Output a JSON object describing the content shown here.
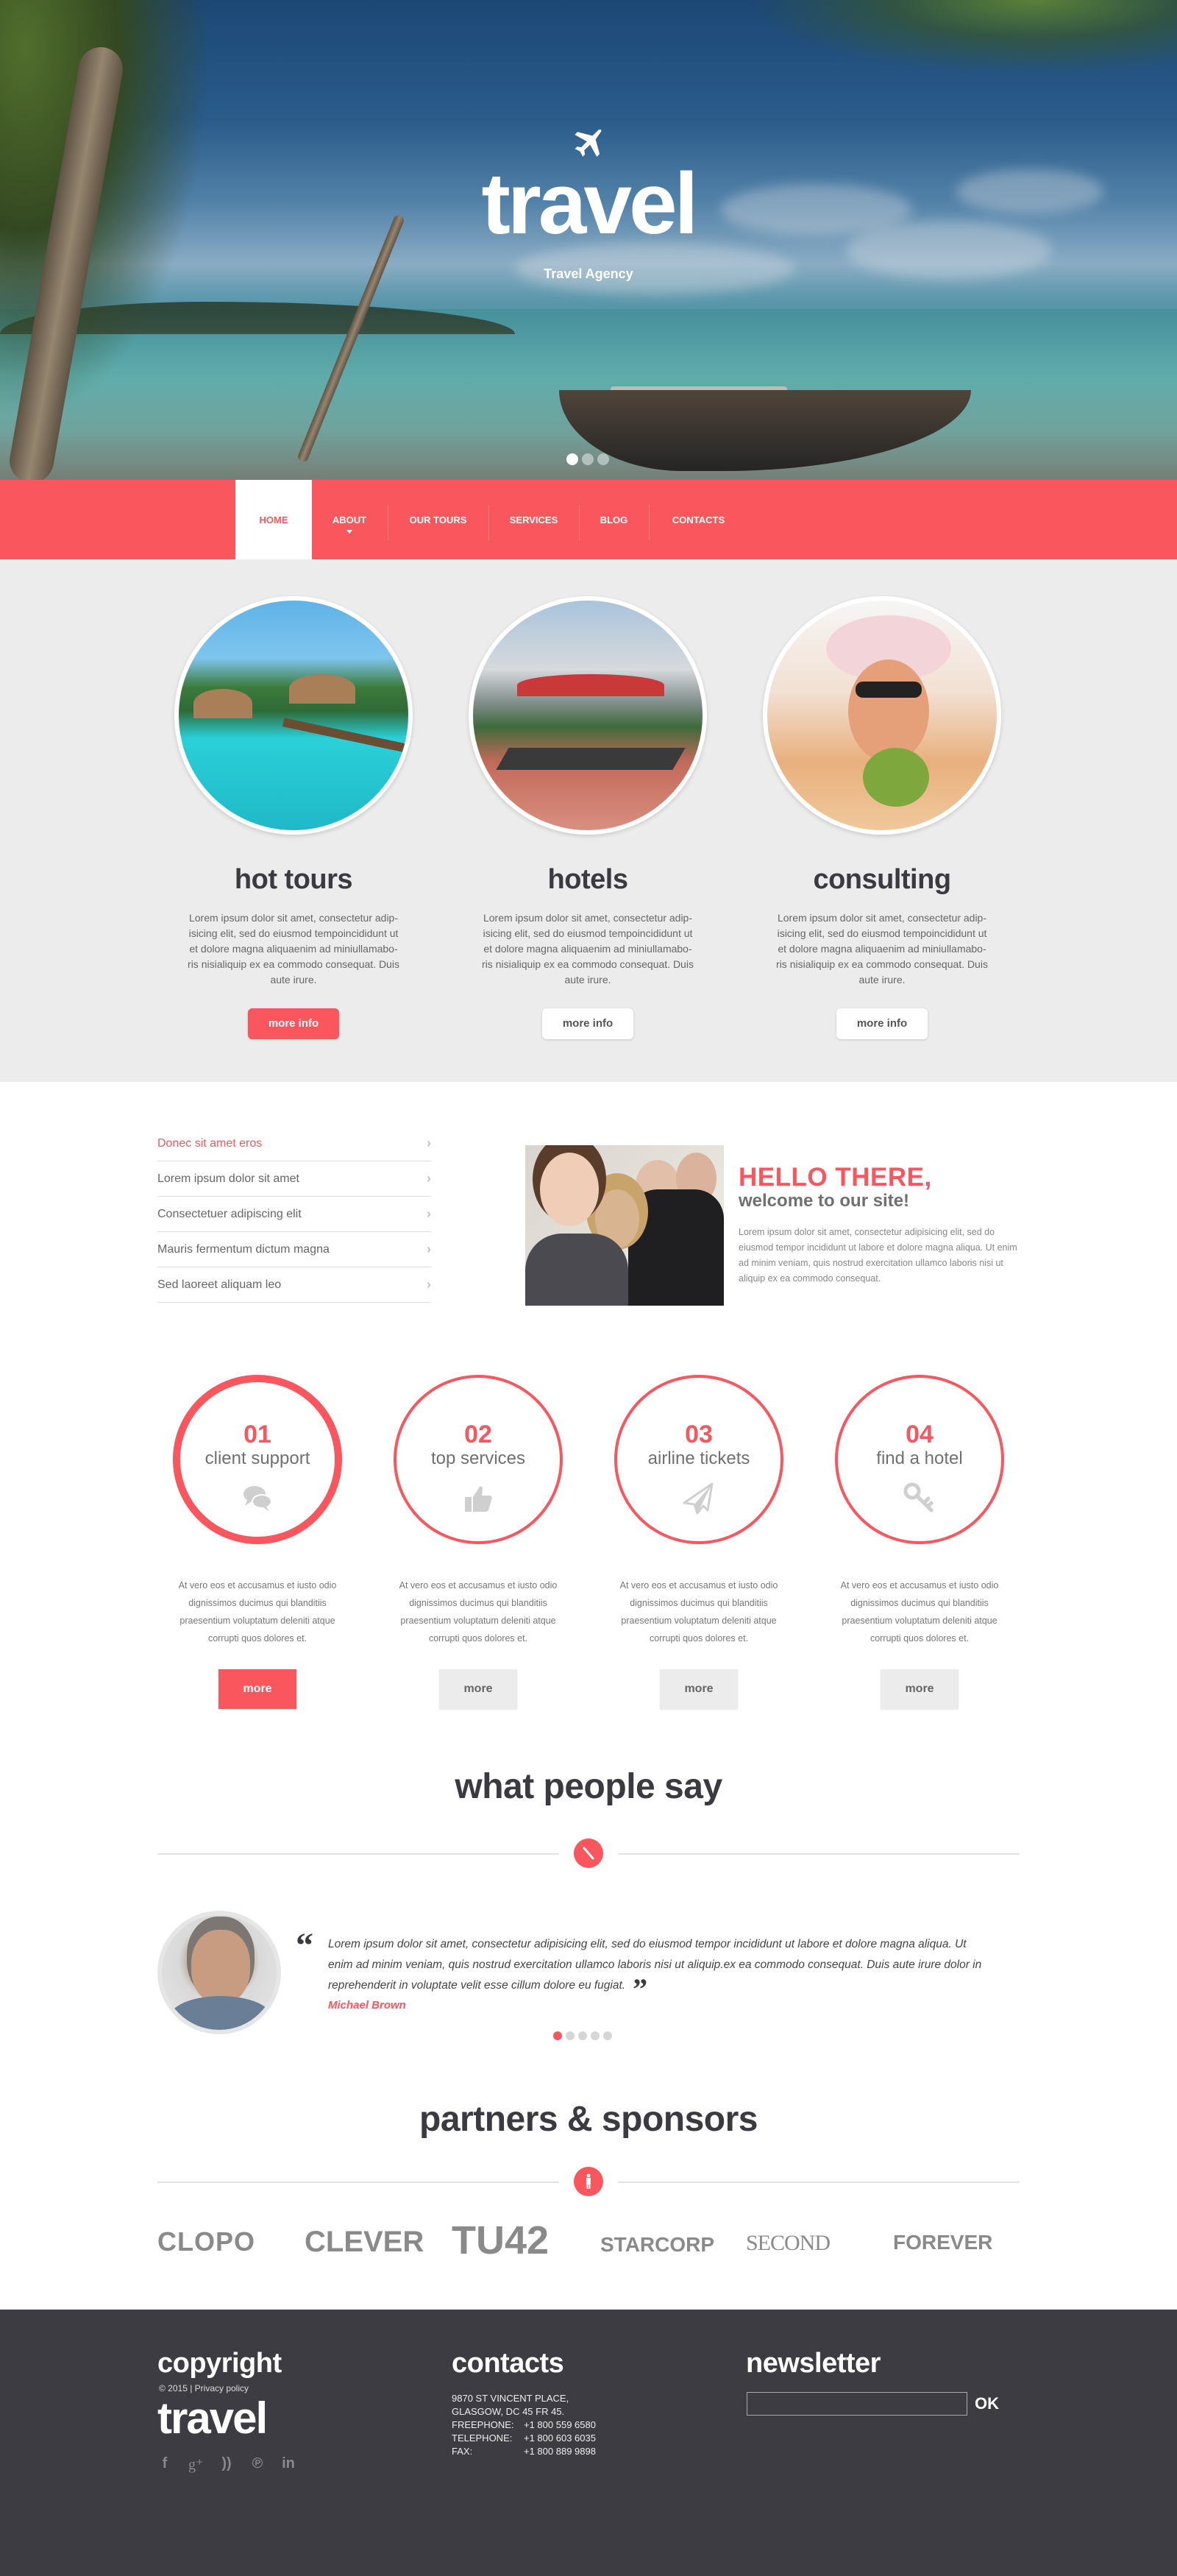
{
  "hero": {
    "logo": "travel",
    "tagline": "Travel Agency",
    "icon": "airplane-icon",
    "slider_dots": {
      "count": 3,
      "active": 0
    }
  },
  "nav": {
    "items": [
      {
        "label": "HOME",
        "active": true
      },
      {
        "label": "ABOUT",
        "has_dropdown": true
      },
      {
        "label": "OUR TOURS"
      },
      {
        "label": "SERVICES"
      },
      {
        "label": "BLOG"
      },
      {
        "label": "CONTACTS"
      }
    ]
  },
  "features": [
    {
      "title": "hot tours",
      "text": "Lorem ipsum dolor sit amet, consectetur adip-isicing elit, sed do eiusmod tempoincididunt ut et dolore magna aliquaenim ad miniullamabo-ris nisialiquip ex ea commodo consequat. Duis aute irure.",
      "button": "more info",
      "image": "tropical-resort-pier"
    },
    {
      "title": "hotels",
      "text": "Lorem ipsum dolor sit amet, consectetur adip-isicing elit, sed do eiusmod tempoincididunt ut et dolore magna aliquaenim ad miniullamabo-ris nisialiquip ex ea commodo consequat. Duis aute irure.",
      "button": "more info",
      "image": "hotel-pool-loungers"
    },
    {
      "title": "consulting",
      "text": "Lorem ipsum dolor sit amet, consectetur adip-isicing elit, sed do eiusmod tempoincididunt ut et dolore magna aliquaenim ad miniullamabo-ris nisialiquip ex ea commodo consequat. Duis aute irure.",
      "button": "more info",
      "image": "woman-with-coconut"
    }
  ],
  "links": [
    {
      "label": "Donec sit amet eros",
      "active": true
    },
    {
      "label": "Lorem ipsum dolor sit amet"
    },
    {
      "label": "Consectetuer adipiscing elit"
    },
    {
      "label": "Mauris fermentum dictum magna"
    },
    {
      "label": "Sed laoreet aliquam leo"
    }
  ],
  "welcome": {
    "heading": "HELLO THERE,",
    "subheading": "welcome to our site!",
    "text": "Lorem ipsum dolor sit amet, consectetur adipisicing elit, sed do eiusmod tempor incididunt ut labore et dolore magna aliqua. Ut enim ad minim veniam, quis nostrud exercitation ullamco laboris nisi ut aliquip ex ea commodo consequat.",
    "image": "business-team-photo"
  },
  "services": [
    {
      "num": "01",
      "label": "client support",
      "icon": "chat-bubbles-icon",
      "text": "At vero eos et accusamus et iusto odio dignissimos ducimus qui blanditiis praesentium voluptatum deleniti atque corrupti quos dolores et.",
      "button": "more"
    },
    {
      "num": "02",
      "label": "top services",
      "icon": "thumbs-up-icon",
      "text": "At vero eos et accusamus et iusto odio dignissimos ducimus qui blanditiis praesentium voluptatum deleniti atque corrupti quos dolores et.",
      "button": "more"
    },
    {
      "num": "03",
      "label": "airline tickets",
      "icon": "paper-plane-icon",
      "text": "At vero eos et accusamus et iusto odio dignissimos ducimus qui blanditiis praesentium voluptatum deleniti atque corrupti quos dolores et.",
      "button": "more"
    },
    {
      "num": "04",
      "label": "find a hotel",
      "icon": "key-icon",
      "text": "At vero eos et accusamus et iusto odio dignissimos ducimus qui blanditiis praesentium voluptatum deleniti atque corrupti quos dolores et.",
      "button": "more"
    }
  ],
  "testimonials": {
    "title": "what people say",
    "quote": "Lorem ipsum dolor sit amet, consectetur adipisicing elit, sed do eiusmod tempor incididunt ut labore et dolore magna aliqua. Ut enim ad minim veniam, quis nostrud exercitation ullamco laboris nisi ut aliquip.ex ea commodo consequat. Duis aute irure dolor in reprehenderit in voluptate velit esse cillum dolore eu fugiat.",
    "author": "Michael Brown",
    "dots": {
      "count": 5,
      "active": 0
    }
  },
  "partners": {
    "title": "partners & sponsors",
    "logos": [
      "CLOPO",
      "CLEVER",
      "TU42",
      "STARCORP",
      "SECOND",
      "FOREVER"
    ]
  },
  "footer": {
    "copyright_title": "copyright",
    "copyright_text": "© 2015 | Privacy policy",
    "logo": "travel",
    "social": [
      "facebook-icon",
      "google-plus-icon",
      "rss-icon",
      "pinterest-icon",
      "linkedin-icon"
    ],
    "contacts_title": "contacts",
    "address": [
      "9870 ST VINCENT PLACE,",
      "GLASGOW, DC 45 FR 45."
    ],
    "phones": [
      {
        "label": "FREEPHONE:",
        "value": "+1 800 559 6580"
      },
      {
        "label": "TELEPHONE:",
        "value": "+1 800 603 6035"
      },
      {
        "label": "FAX:",
        "value": "+1 800 889 9898"
      }
    ],
    "newsletter_title": "newsletter",
    "newsletter_value": "",
    "newsletter_button": "OK"
  },
  "colors": {
    "accent": "#f9565e",
    "dark": "#3d3c42",
    "light_bg": "#ececec"
  }
}
